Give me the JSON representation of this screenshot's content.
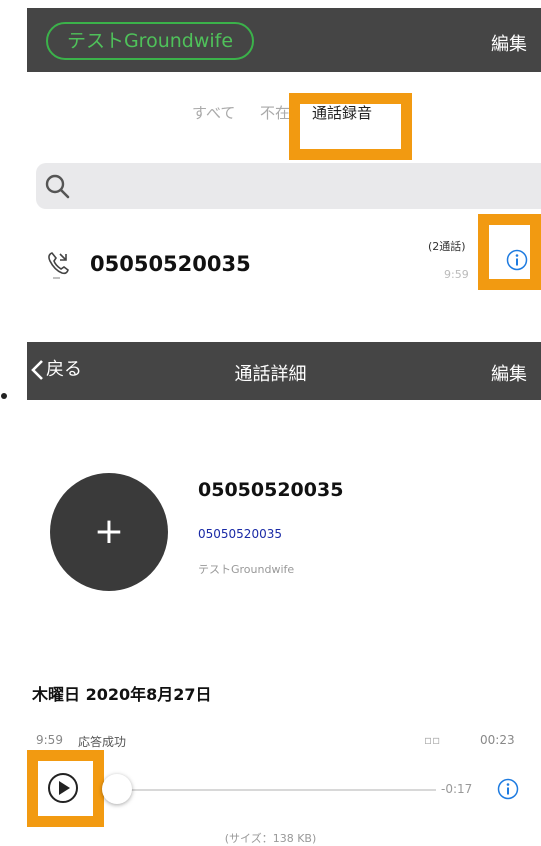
{
  "top_screen": {
    "tenant_name": "テストGroundwife",
    "edit_label": "編集",
    "tabs": [
      {
        "label": "すべて"
      },
      {
        "label": "不在"
      },
      {
        "label": "通話録音"
      }
    ],
    "search": {
      "placeholder": ""
    },
    "call_entry": {
      "number": "05050520035",
      "count": "(2通話)",
      "time": "9:59"
    }
  },
  "detail_screen": {
    "back_label": "戻る",
    "title": "通話詳細",
    "edit_label": "編集",
    "avatar_symbol": "+",
    "contact": {
      "name": "05050520035",
      "number": "05050520035",
      "organization": "テストGroundwife"
    },
    "date_heading": "木曜日 2020年8月27日",
    "recording": {
      "time": "9:59",
      "status": "応答成功",
      "marker": "▫▫",
      "duration": "00:23",
      "remaining": "-0:17",
      "progress": 0,
      "file_size": "(サイズ：138 KB)"
    }
  },
  "colors": {
    "header_bg": "#454545",
    "highlight": "#f29a11",
    "tenant_green": "#3bb24a",
    "link_blue": "#1a2aa6",
    "avatar_bg": "#3a3a3a",
    "info_blue": "#1e7be0"
  },
  "icons": [
    "search-icon",
    "phone-icon",
    "info-icon",
    "chevron-left-icon",
    "play-icon",
    "plus-icon"
  ]
}
